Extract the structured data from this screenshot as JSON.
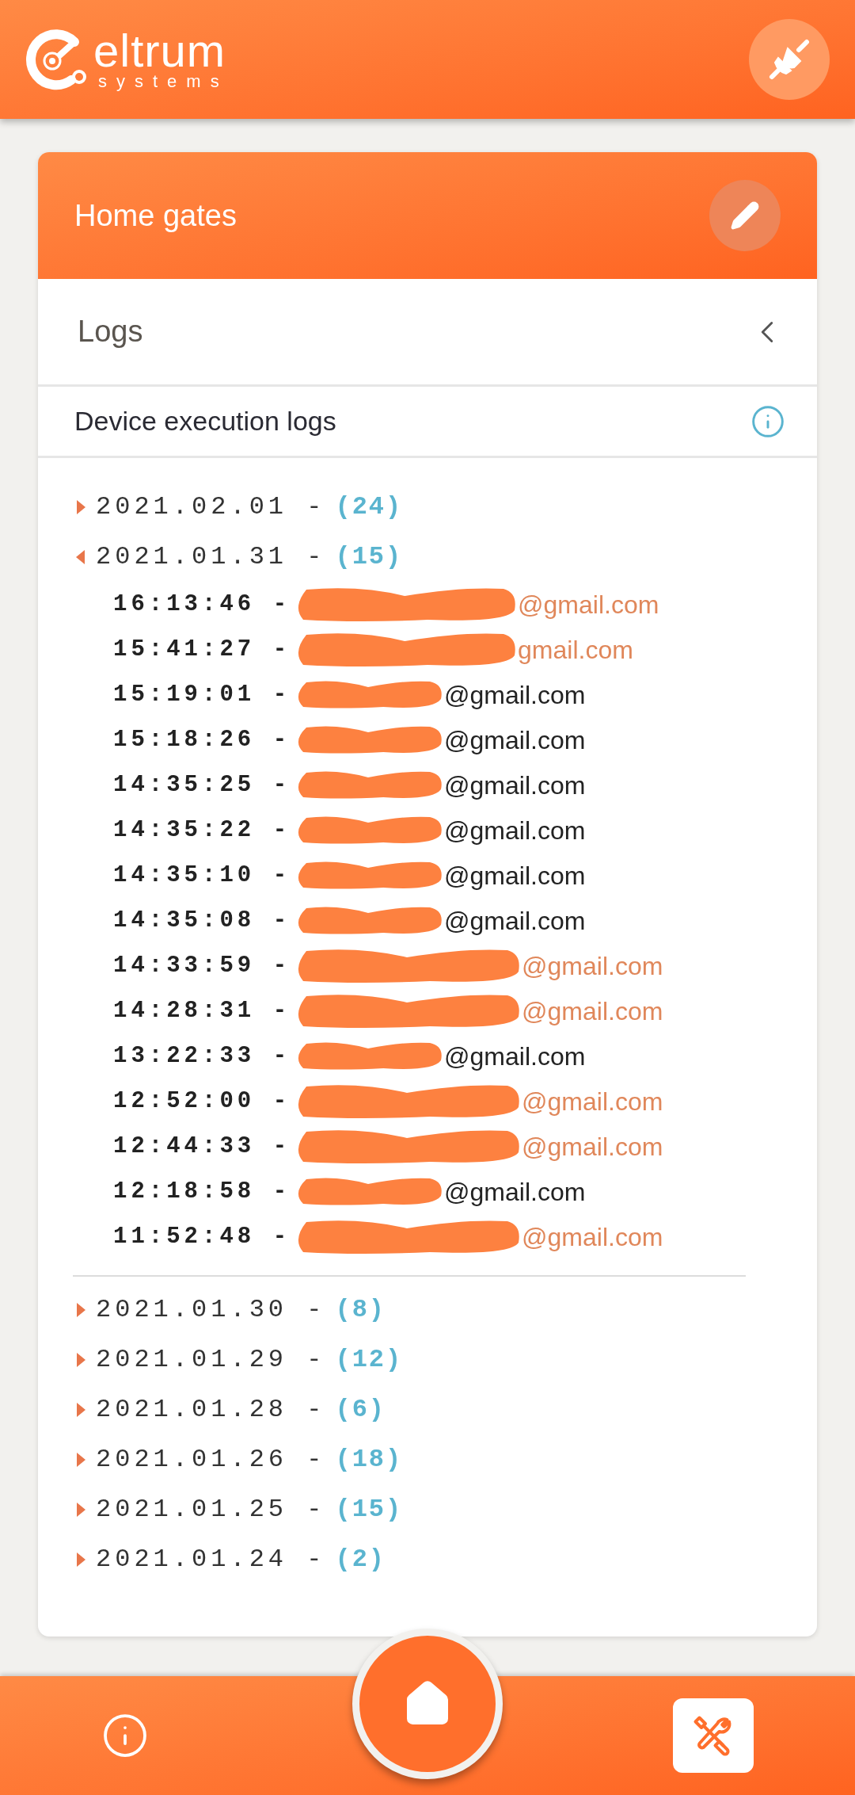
{
  "header": {
    "logo_name": "eltrum",
    "logo_sub": "systems"
  },
  "card": {
    "title": "Home gates",
    "section": "Logs",
    "subsection": "Device execution logs",
    "days": [
      {
        "date": "2021.02.01 -",
        "count": "(24)",
        "expanded": false
      },
      {
        "date": "2021.01.31 -",
        "count": "(15)",
        "expanded": true,
        "entries": [
          {
            "time": "16:13:46 -",
            "email": "@gmail.com",
            "color": "#e0875a"
          },
          {
            "time": "15:41:27 -",
            "email": "gmail.com",
            "color": "#e0875a"
          },
          {
            "time": "15:19:01 -",
            "email": "@gmail.com",
            "color": "#222222"
          },
          {
            "time": "15:18:26 -",
            "email": "@gmail.com",
            "color": "#222222"
          },
          {
            "time": "14:35:25 -",
            "email": "@gmail.com",
            "color": "#222222"
          },
          {
            "time": "14:35:22 -",
            "email": "@gmail.com",
            "color": "#222222"
          },
          {
            "time": "14:35:10 -",
            "email": "@gmail.com",
            "color": "#222222"
          },
          {
            "time": "14:35:08 -",
            "email": "@gmail.com",
            "color": "#222222"
          },
          {
            "time": "14:33:59 -",
            "email": "@gmail.com",
            "color": "#e0875a"
          },
          {
            "time": "14:28:31 -",
            "email": "@gmail.com",
            "color": "#e0875a"
          },
          {
            "time": "13:22:33 -",
            "email": "@gmail.com",
            "color": "#222222"
          },
          {
            "time": "12:52:00 -",
            "email": "@gmail.com",
            "color": "#e0875a"
          },
          {
            "time": "12:44:33 -",
            "email": "@gmail.com",
            "color": "#e0875a"
          },
          {
            "time": "12:18:58 -",
            "email": "@gmail.com",
            "color": "#222222"
          },
          {
            "time": "11:52:48 -",
            "email": "@gmail.com",
            "color": "#e0875a"
          }
        ]
      },
      {
        "date": "2021.01.30 -",
        "count": "(8)",
        "expanded": false
      },
      {
        "date": "2021.01.29 -",
        "count": "(12)",
        "expanded": false
      },
      {
        "date": "2021.01.28 -",
        "count": "(6)",
        "expanded": false
      },
      {
        "date": "2021.01.26 -",
        "count": "(18)",
        "expanded": false
      },
      {
        "date": "2021.01.25 -",
        "count": "(15)",
        "expanded": false
      },
      {
        "date": "2021.01.24 -",
        "count": "(2)",
        "expanded": false
      }
    ]
  }
}
